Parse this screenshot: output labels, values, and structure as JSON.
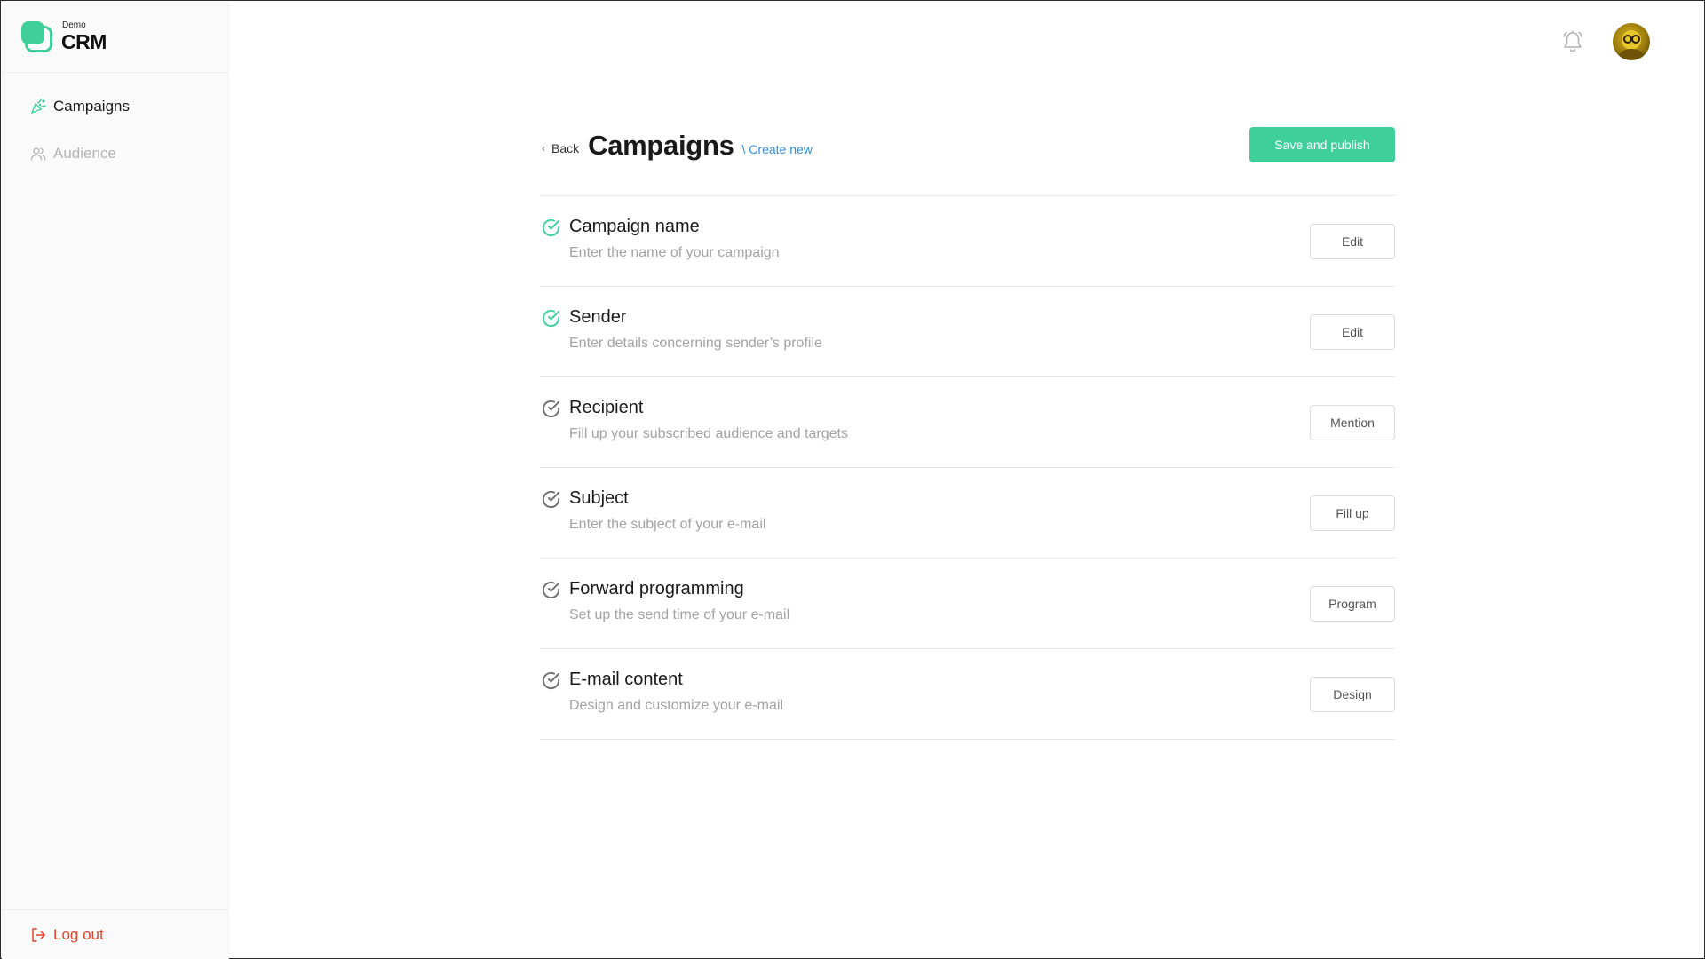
{
  "app": {
    "logo_small": "Demo",
    "logo_big": "CRM",
    "accent_color": "#3ecf9a",
    "link_color": "#2f8fe0",
    "danger_color": "#e2452c"
  },
  "sidebar": {
    "items": [
      {
        "label": "Campaigns",
        "icon": "confetti-icon",
        "active": true
      },
      {
        "label": "Audience",
        "icon": "users-icon",
        "active": false
      }
    ],
    "logout_label": "Log out",
    "logout_icon": "logout-icon"
  },
  "topbar": {
    "bell_icon": "bell-icon",
    "avatar": "user-avatar"
  },
  "header": {
    "back_label": "Back",
    "title": "Campaigns",
    "breadcrumb_create": "\\ Create new",
    "publish_label": "Save and publish"
  },
  "steps": [
    {
      "title": "Campaign name",
      "description": "Enter the name of your campaign",
      "action": "Edit",
      "completed": true
    },
    {
      "title": "Sender",
      "description": "Enter details concerning sender’s profile",
      "action": "Edit",
      "completed": true
    },
    {
      "title": "Recipient",
      "description": "Fill up your subscribed audience and targets",
      "action": "Mention",
      "completed": false
    },
    {
      "title": "Subject",
      "description": "Enter the subject of your e-mail",
      "action": "Fill up",
      "completed": false
    },
    {
      "title": "Forward programming",
      "description": "Set up the send time of your e-mail",
      "action": "Program",
      "completed": false
    },
    {
      "title": "E-mail content",
      "description": "Design and customize your e-mail",
      "action": "Design",
      "completed": false
    }
  ]
}
